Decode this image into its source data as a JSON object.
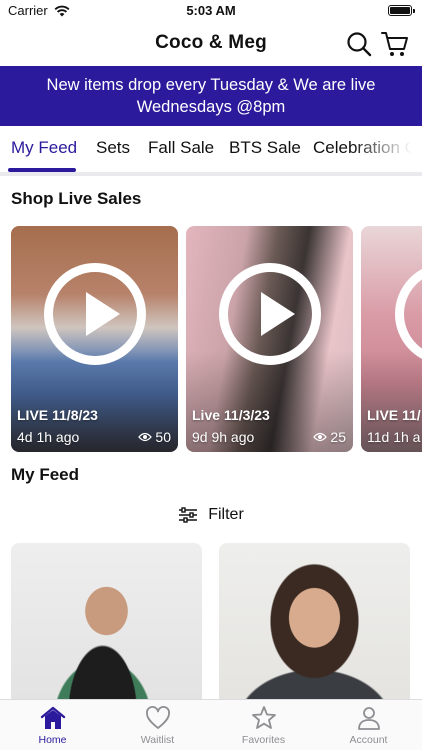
{
  "status_bar": {
    "carrier": "Carrier",
    "time": "5:03 AM"
  },
  "header": {
    "title": "Coco & Meg",
    "search_icon": "search-icon",
    "cart_icon": "cart-icon"
  },
  "banner": {
    "line1": "New items drop every Tuesday & We are live",
    "line2": "Wednesdays @8pm"
  },
  "tabs": [
    {
      "label": "My Feed",
      "active": true
    },
    {
      "label": "Sets"
    },
    {
      "label": "Fall Sale"
    },
    {
      "label": "BTS Sale"
    },
    {
      "label": "Celebration C"
    }
  ],
  "live_section": {
    "title": "Shop Live Sales",
    "cards": [
      {
        "label": "LIVE 11/8/23",
        "ago": "4d 1h ago",
        "views": "50"
      },
      {
        "label": "Live 11/3/23",
        "ago": "9d 9h ago",
        "views": "25"
      },
      {
        "label": "LIVE 11/",
        "ago": "11d 1h a",
        "views": ""
      }
    ]
  },
  "feed_section": {
    "title": "My Feed",
    "filter_label": "Filter"
  },
  "tabbar": {
    "items": [
      {
        "label": "Home",
        "icon": "home-icon",
        "active": true
      },
      {
        "label": "Waitlist",
        "icon": "heart-icon"
      },
      {
        "label": "Favorites",
        "icon": "star-icon"
      },
      {
        "label": "Account",
        "icon": "person-icon"
      }
    ]
  },
  "colors": {
    "brand": "#2b1a9c",
    "inactive": "#8e8e93"
  }
}
